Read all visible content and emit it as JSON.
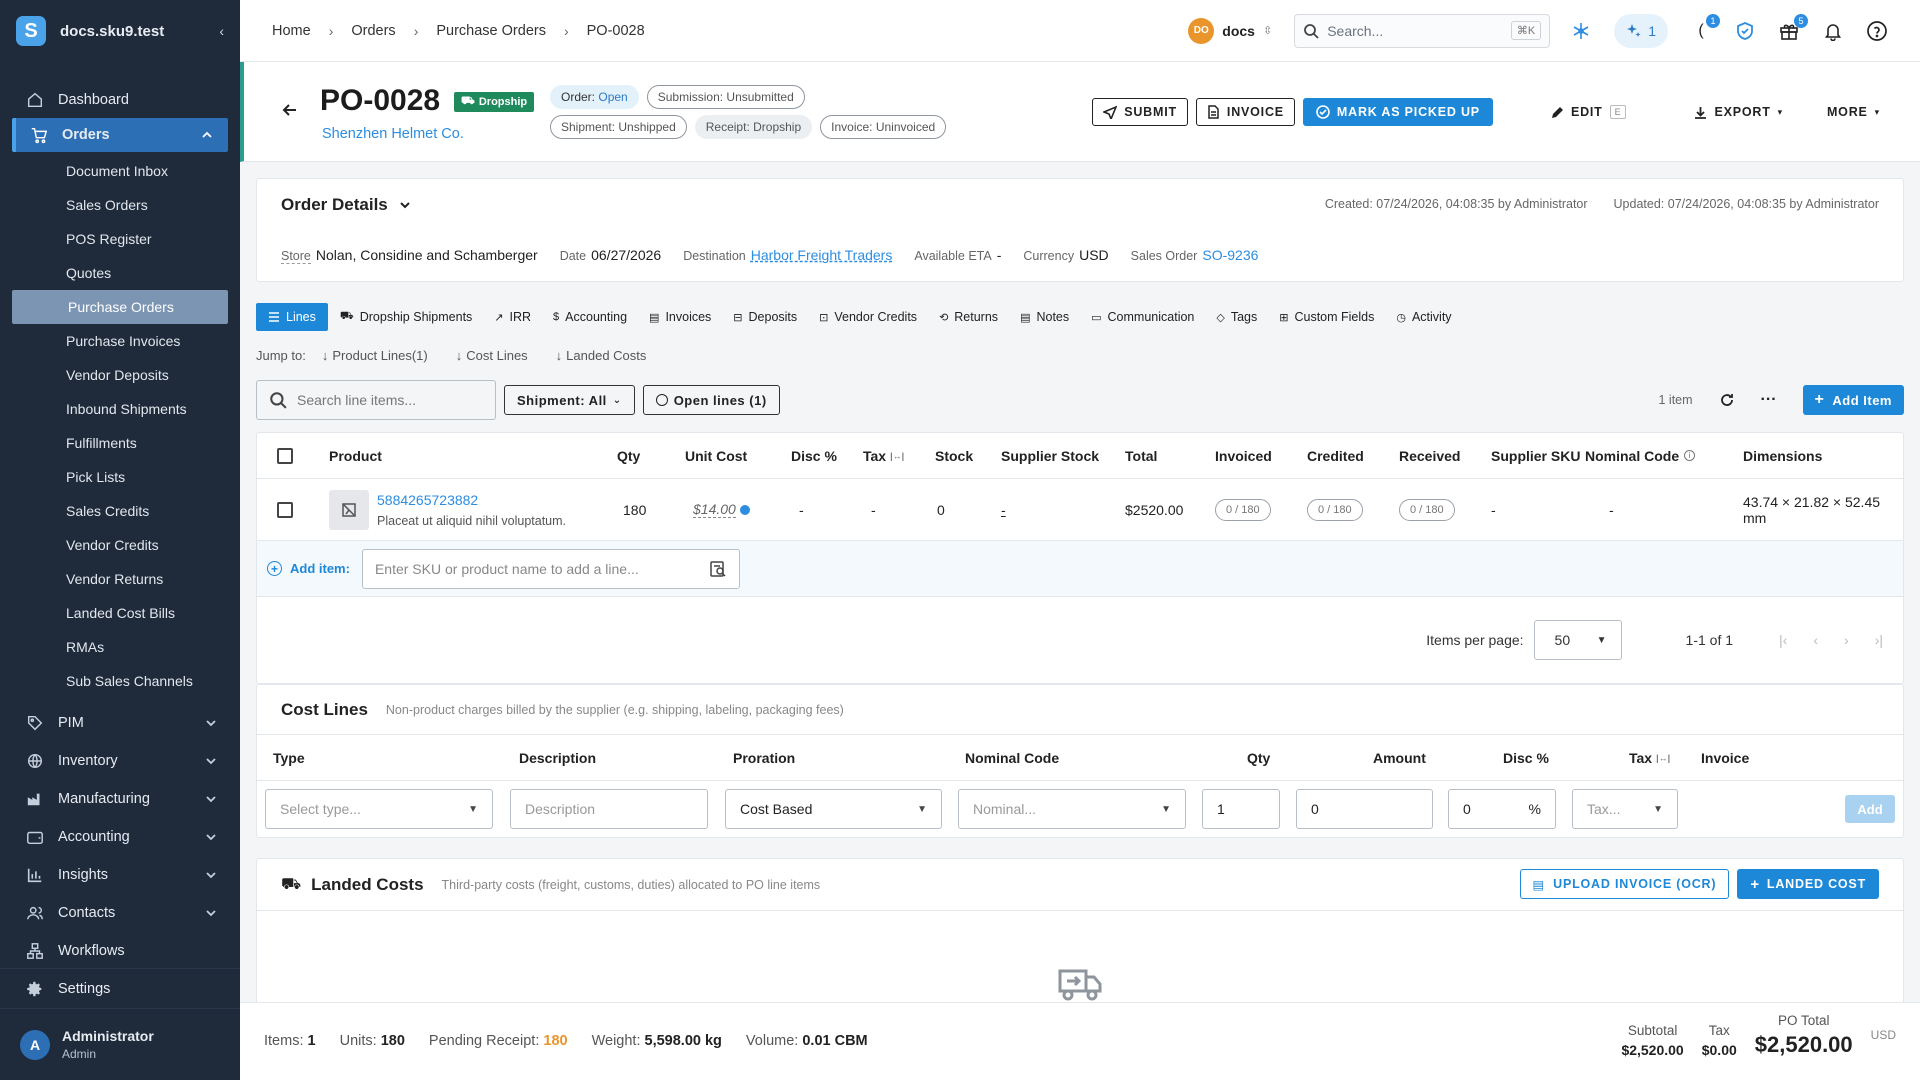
{
  "app": {
    "workspace": "docs.sku9.test",
    "logo_letter": "S"
  },
  "sidebar": {
    "items": [
      {
        "label": "Dashboard"
      },
      {
        "label": "Orders"
      },
      {
        "label": "PIM"
      },
      {
        "label": "Inventory"
      },
      {
        "label": "Manufacturing"
      },
      {
        "label": "Accounting"
      },
      {
        "label": "Insights"
      },
      {
        "label": "Contacts"
      },
      {
        "label": "Workflows"
      }
    ],
    "orders_sub": [
      {
        "label": "Document Inbox"
      },
      {
        "label": "Sales Orders"
      },
      {
        "label": "POS Register"
      },
      {
        "label": "Quotes"
      },
      {
        "label": "Purchase Orders"
      },
      {
        "label": "Purchase Invoices"
      },
      {
        "label": "Vendor Deposits"
      },
      {
        "label": "Inbound Shipments"
      },
      {
        "label": "Fulfillments"
      },
      {
        "label": "Pick Lists"
      },
      {
        "label": "Sales Credits"
      },
      {
        "label": "Vendor Credits"
      },
      {
        "label": "Vendor Returns"
      },
      {
        "label": "Landed Cost Bills"
      },
      {
        "label": "RMAs"
      },
      {
        "label": "Sub Sales Channels"
      }
    ],
    "settings": "Settings",
    "user": {
      "initial": "A",
      "name": "Administrator",
      "role": "Admin"
    }
  },
  "topbar": {
    "breadcrumb": [
      "Home",
      "Orders",
      "Purchase Orders",
      "PO-0028"
    ],
    "tenant_initials": "DO",
    "tenant_name": "docs",
    "search_placeholder": "Search...",
    "search_shortcut": "⌘K",
    "ai_count": "1",
    "tasks_badge": "1",
    "gift_badge": "5"
  },
  "header": {
    "po_number": "PO-0028",
    "type_tag": "Dropship",
    "vendor": "Shenzhen Helmet Co.",
    "status_order_label": "Order:",
    "status_order_value": "Open",
    "status_submission": "Submission: Unsubmitted",
    "status_shipment": "Shipment: Unshipped",
    "status_receipt": "Receipt: Dropship",
    "status_invoice": "Invoice: Uninvoiced",
    "actions": {
      "submit": "SUBMIT",
      "invoice": "INVOICE",
      "mark_picked": "MARK AS PICKED UP",
      "edit": "EDIT",
      "edit_key": "E",
      "export": "EXPORT",
      "more": "MORE"
    }
  },
  "order_details": {
    "title": "Order Details",
    "created": "Created: 07/24/2026, 04:08:35 by Administrator",
    "updated": "Updated: 07/24/2026, 04:08:35 by Administrator",
    "store_label": "Store",
    "store": "Nolan, Considine and Schamberger",
    "date_label": "Date",
    "date": "06/27/2026",
    "destination_label": "Destination",
    "destination": "Harbor Freight Traders",
    "eta_label": "Available ETA",
    "eta": "-",
    "currency_label": "Currency",
    "currency": "USD",
    "sales_order_label": "Sales Order",
    "sales_order": "SO-9236"
  },
  "tabs": [
    "Lines",
    "Dropship Shipments",
    "IRR",
    "Accounting",
    "Invoices",
    "Deposits",
    "Vendor Credits",
    "Returns",
    "Notes",
    "Communication",
    "Tags",
    "Custom Fields",
    "Activity"
  ],
  "jump": {
    "label": "Jump to:",
    "links": [
      "Product Lines(1)",
      "Cost Lines",
      "Landed Costs"
    ]
  },
  "toolbar": {
    "search_placeholder": "Search line items...",
    "shipment_filter": "Shipment: All",
    "open_lines": "Open lines (1)",
    "item_count": "1 item",
    "add_item": "Add Item"
  },
  "lines_table": {
    "columns": [
      "Product",
      "Qty",
      "Unit Cost",
      "Disc %",
      "Tax",
      "Stock",
      "Supplier Stock",
      "Total",
      "Invoiced",
      "Credited",
      "Received",
      "Supplier SKU",
      "Nominal Code",
      "Dimensions"
    ],
    "rows": [
      {
        "sku": "5884265723882",
        "description": "Placeat ut aliquid nihil voluptatum.",
        "qty": "180",
        "unit_cost": "$14.00",
        "disc": "-",
        "tax": "-",
        "stock": "0",
        "supplier_stock": "-",
        "total": "$2520.00",
        "invoiced": "0 / 180",
        "credited": "0 / 180",
        "received": "0 / 180",
        "supplier_sku": "-",
        "nominal_code": "-",
        "dimensions": "43.74 × 21.82 × 52.45 mm"
      }
    ],
    "add_item_label": "Add item:",
    "add_item_placeholder": "Enter SKU or product name to add a line..."
  },
  "pager": {
    "per_page_label": "Items per page:",
    "per_page": "50",
    "range": "1-1 of 1"
  },
  "cost_lines": {
    "title": "Cost Lines",
    "subtitle": "Non-product charges billed by the supplier (e.g. shipping, labeling, packaging fees)",
    "columns": [
      "Type",
      "Description",
      "Proration",
      "Nominal Code",
      "Qty",
      "Amount",
      "Disc %",
      "Tax",
      "Invoice"
    ],
    "type_placeholder": "Select type...",
    "desc_placeholder": "Description",
    "proration": "Cost Based",
    "nominal_placeholder": "Nominal...",
    "qty": "1",
    "amount": "0",
    "disc": "0",
    "disc_unit": "%",
    "tax_placeholder": "Tax...",
    "add": "Add"
  },
  "landed_costs": {
    "title": "Landed Costs",
    "subtitle": "Third-party costs (freight, customs, duties) allocated to PO line items",
    "upload": "UPLOAD INVOICE (OCR)",
    "add": "LANDED COST"
  },
  "footer": {
    "items_label": "Items:",
    "items": "1",
    "units_label": "Units:",
    "units": "180",
    "pending_label": "Pending Receipt:",
    "pending": "180",
    "weight_label": "Weight:",
    "weight": "5,598.00 kg",
    "volume_label": "Volume:",
    "volume": "0.01 CBM",
    "subtotal_label": "Subtotal",
    "subtotal": "$2,520.00",
    "tax_label": "Tax",
    "tax": "$0.00",
    "total_label": "PO Total",
    "total": "$2,520.00",
    "currency": "USD"
  }
}
